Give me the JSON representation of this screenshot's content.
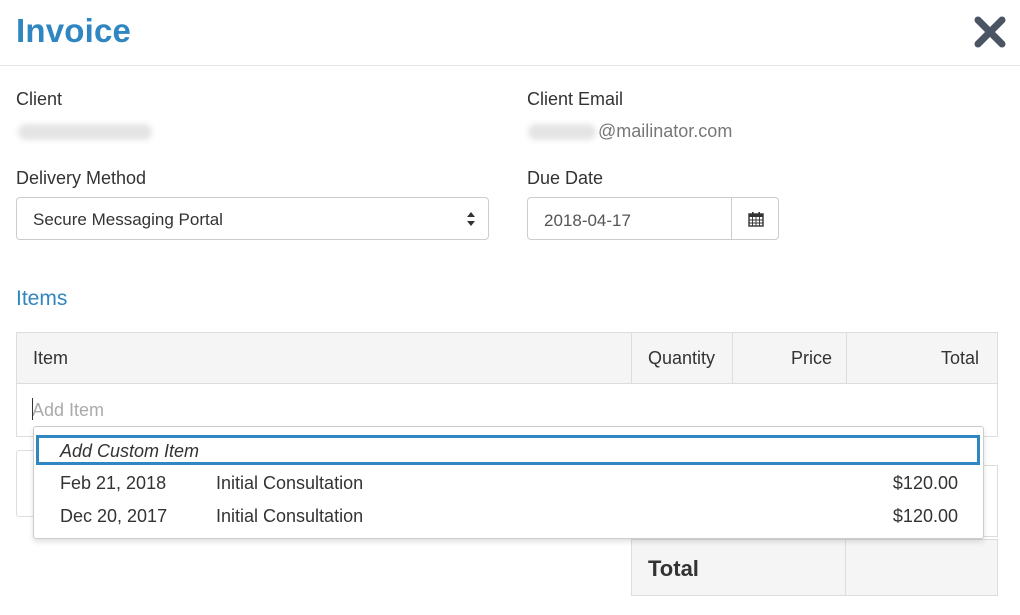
{
  "header": {
    "title": "Invoice",
    "close_icon": "close-x-icon"
  },
  "client": {
    "label": "Client",
    "value_redacted": true
  },
  "client_email": {
    "label": "Client Email",
    "domain": "@mailinator.com"
  },
  "delivery_method": {
    "label": "Delivery Method",
    "selected": "Secure Messaging Portal"
  },
  "due_date": {
    "label": "Due Date",
    "value": "2018-04-17",
    "icon": "calendar-icon"
  },
  "items": {
    "section_title": "Items",
    "columns": [
      "Item",
      "Quantity",
      "Price",
      "Total"
    ],
    "add_item_placeholder": "Add Item",
    "dropdown": {
      "custom_option": "Add Custom Item",
      "options": [
        {
          "date": "Feb 21, 2018",
          "description": "Initial Consultation",
          "amount": "$120.00"
        },
        {
          "date": "Dec 20, 2017",
          "description": "Initial Consultation",
          "amount": "$120.00"
        }
      ]
    },
    "total_label": "Total"
  },
  "colors": {
    "accent": "#2f86c1",
    "close": "#4a5563",
    "border": "#dddddd",
    "header_bg": "#f5f5f5"
  }
}
